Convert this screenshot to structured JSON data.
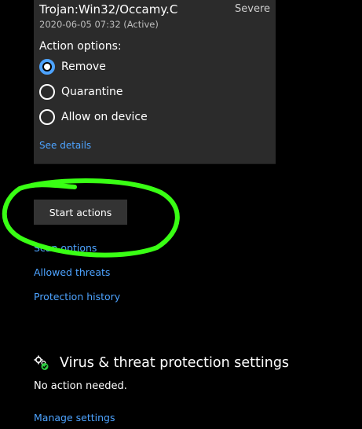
{
  "threat": {
    "name": "Trojan:Win32/Occamy.C",
    "severity": "Severe",
    "date": "2020-06-05 07:32 (Active)",
    "options_label": "Action options:",
    "options": [
      {
        "label": "Remove",
        "selected": true
      },
      {
        "label": "Quarantine",
        "selected": false
      },
      {
        "label": "Allow on device",
        "selected": false
      }
    ],
    "see_details": "See details"
  },
  "actions": {
    "start_label": "Start actions"
  },
  "links": {
    "scan_options": "Scan options",
    "allowed_threats": "Allowed threats",
    "protection_history": "Protection history"
  },
  "settings_section": {
    "icon": "settings-gear-check-icon",
    "title": "Virus & threat protection settings",
    "status": "No action needed.",
    "manage_link": "Manage settings"
  },
  "colors": {
    "background": "#000000",
    "card": "#2b2b2b",
    "accent_link": "#4da3ff",
    "button": "#333333",
    "annotation_stroke": "#39ff14"
  }
}
